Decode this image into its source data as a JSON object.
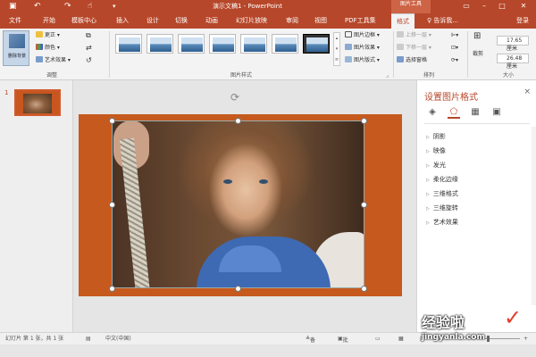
{
  "window": {
    "title": "演示文稿1 - PowerPoint",
    "context_tab_group": "图片工具",
    "quick_access": [
      "save-icon",
      "undo-icon",
      "redo-icon",
      "customize-icon"
    ],
    "controls": [
      "ribbon-display-icon",
      "minimize-icon",
      "maximize-icon",
      "close-icon"
    ]
  },
  "tabs": [
    {
      "label": "文件"
    },
    {
      "label": "开始"
    },
    {
      "label": "模板中心"
    },
    {
      "label": "插入"
    },
    {
      "label": "设计"
    },
    {
      "label": "切换"
    },
    {
      "label": "动画"
    },
    {
      "label": "幻灯片放映"
    },
    {
      "label": "审阅"
    },
    {
      "label": "视图"
    },
    {
      "label": "PDF工具集"
    },
    {
      "label": "格式",
      "active": true
    }
  ],
  "tell_me": "♀ 告诉我...",
  "login": "登录",
  "ribbon": {
    "adjust": {
      "remove_bg": "删除背景",
      "corrections": "更正 ▾",
      "color": "颜色 ▾",
      "artistic": "艺术效果 ▾",
      "group_label": "调整"
    },
    "picture_styles": {
      "group_label": "图片样式",
      "border": "图片边框 ▾",
      "effects": "图片效果 ▾",
      "layout": "图片版式 ▾"
    },
    "arrange": {
      "bring_forward": "上移一层 ▾",
      "send_backward": "下移一层 ▾",
      "selection_pane": "选择窗格",
      "group_label": "排列"
    },
    "size": {
      "crop": "裁剪",
      "height": "17.65 厘米",
      "width": "26.48 厘米",
      "group_label": "大小"
    }
  },
  "thumbnails": {
    "slide_number": "1"
  },
  "format_pane": {
    "title": "设置图片格式",
    "close": "×",
    "tabs": [
      "fill-line-icon",
      "effects-icon",
      "size-properties-icon",
      "picture-icon"
    ],
    "items": [
      "阴影",
      "映像",
      "发光",
      "柔化边缘",
      "三维格式",
      "三维旋转",
      "艺术效果"
    ]
  },
  "statusbar": {
    "slide_info": "幻灯片 第 1 张，共 1 张",
    "language": "中文(中国)",
    "notes": "备注",
    "comments": "批注"
  },
  "watermark": {
    "line1": "经验啦",
    "line2": "jingyanla.com",
    "check": "✓"
  },
  "colors": {
    "accent": "#b7472a",
    "slide_background": "#c65a1e"
  }
}
